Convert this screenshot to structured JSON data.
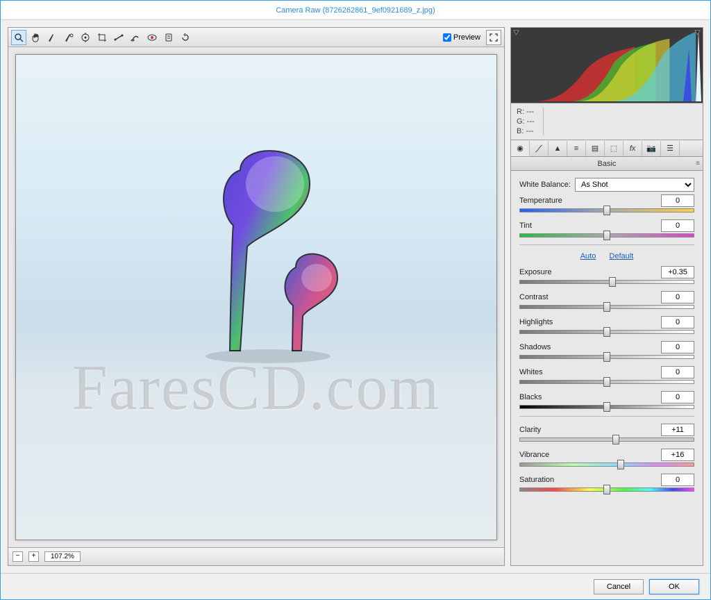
{
  "window": {
    "title": "Camera Raw (8726262861_9ef0921689_z.jpg)"
  },
  "toolbar": {
    "preview_label": "Preview",
    "preview_checked": true
  },
  "zoom": {
    "value": "107.2%"
  },
  "rgb": {
    "r": "R:   ---",
    "g": "G:   ---",
    "b": "B:   ---"
  },
  "panel": {
    "title": "Basic",
    "wb_label": "White Balance:",
    "wb_value": "As Shot",
    "links": {
      "auto": "Auto",
      "default": "Default"
    },
    "sliders": {
      "temperature": {
        "label": "Temperature",
        "value": "0",
        "pos": 50
      },
      "tint": {
        "label": "Tint",
        "value": "0",
        "pos": 50
      },
      "exposure": {
        "label": "Exposure",
        "value": "+0.35",
        "pos": 53
      },
      "contrast": {
        "label": "Contrast",
        "value": "0",
        "pos": 50
      },
      "highlights": {
        "label": "Highlights",
        "value": "0",
        "pos": 50
      },
      "shadows": {
        "label": "Shadows",
        "value": "0",
        "pos": 50
      },
      "whites": {
        "label": "Whites",
        "value": "0",
        "pos": 50
      },
      "blacks": {
        "label": "Blacks",
        "value": "0",
        "pos": 50
      },
      "clarity": {
        "label": "Clarity",
        "value": "+11",
        "pos": 55
      },
      "vibrance": {
        "label": "Vibrance",
        "value": "+16",
        "pos": 58
      },
      "saturation": {
        "label": "Saturation",
        "value": "0",
        "pos": 50
      }
    }
  },
  "buttons": {
    "cancel": "Cancel",
    "ok": "OK"
  },
  "watermark": "FaresCD.com"
}
